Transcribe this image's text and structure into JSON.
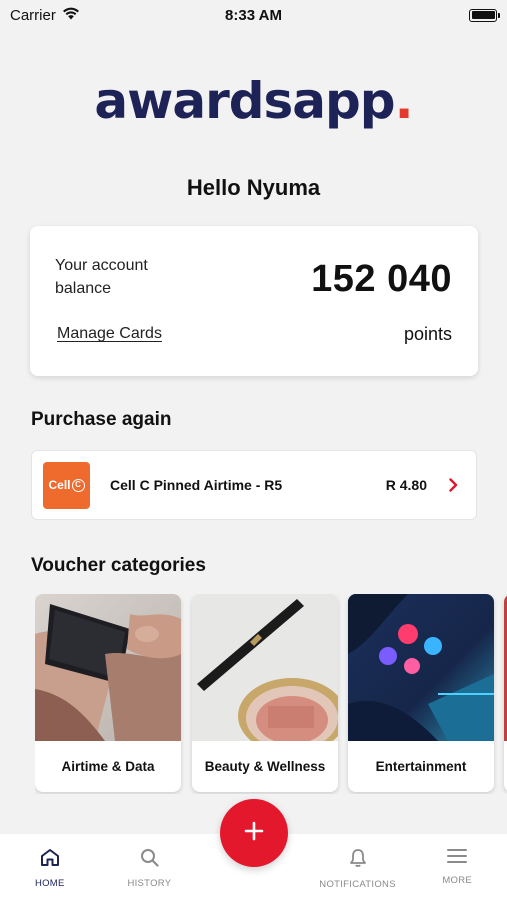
{
  "status_bar": {
    "carrier": "Carrier",
    "time": "8:33 AM"
  },
  "logo": {
    "text": "awardsapp",
    "dot": ".",
    "brand_color": "#1d2257",
    "dot_color": "#e23b2e"
  },
  "greeting": "Hello Nyuma",
  "balance": {
    "label": "Your account balance",
    "value": "152 040",
    "unit": "points",
    "manage_link": "Manage Cards"
  },
  "purchase_again": {
    "title": "Purchase again",
    "item": {
      "logo_text": "Cell",
      "logo_mark": "C",
      "name": "Cell C Pinned Airtime - R5",
      "price": "R 4.80",
      "accent": "#e3182d"
    }
  },
  "voucher_categories": {
    "title": "Voucher categories",
    "items": [
      {
        "label": "Airtime & Data",
        "image": "phone-hands-photo"
      },
      {
        "label": "Beauty & Wellness",
        "image": "cosmetics-photo"
      },
      {
        "label": "Entertainment",
        "image": "game-controller-photo"
      }
    ]
  },
  "bottom_nav": {
    "items": [
      {
        "label": "HOME",
        "icon": "home-icon",
        "active": true
      },
      {
        "label": "HISTORY",
        "icon": "search-icon",
        "active": false
      },
      {
        "label": "NOTIFICATIONS",
        "icon": "bell-icon",
        "active": false
      },
      {
        "label": "MORE",
        "icon": "menu-icon",
        "active": false
      }
    ],
    "fab_icon": "plus-icon",
    "fab_color": "#e3182d"
  }
}
